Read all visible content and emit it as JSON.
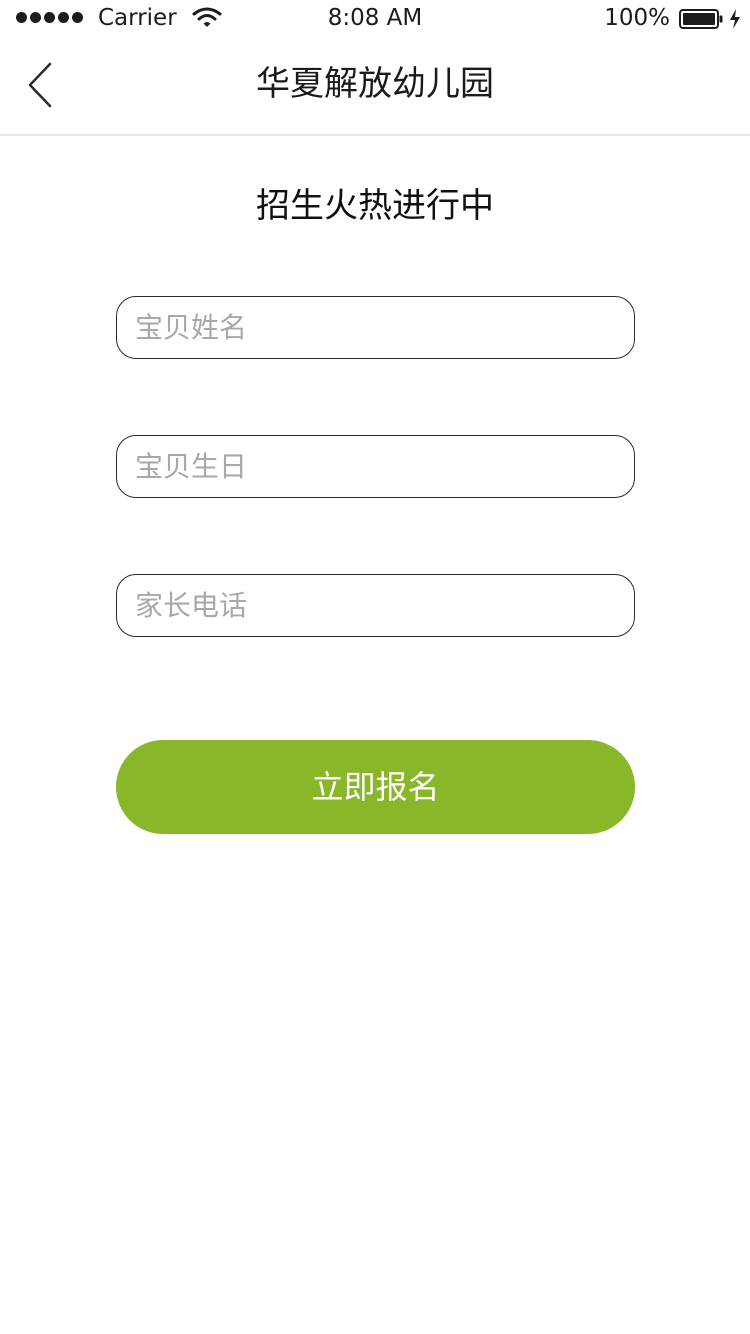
{
  "status_bar": {
    "carrier": "Carrier",
    "time": "8:08 AM",
    "battery_percent": "100%",
    "icons": [
      "signal-dots-icon",
      "wifi-icon",
      "battery-icon",
      "charging-icon"
    ]
  },
  "nav": {
    "back_icon": "chevron-left-icon",
    "title": "华夏解放幼儿园"
  },
  "main": {
    "headline": "招生火热进行中",
    "form": {
      "child_name_placeholder": "宝贝姓名",
      "child_birthday_placeholder": "宝贝生日",
      "parent_phone_placeholder": "家长电话",
      "submit_label": "立即报名"
    }
  },
  "colors": {
    "accent": "#8ab62a",
    "background": "#ffffff",
    "field_border": "#2b2b2b",
    "placeholder": "#a8a8a8"
  }
}
